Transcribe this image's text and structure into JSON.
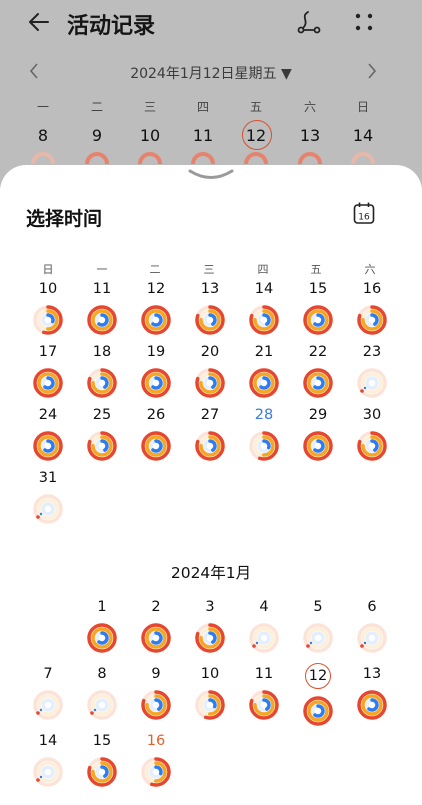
{
  "header": {
    "title": "活动记录",
    "date_text": "2024年1月12日星期五 ▼"
  },
  "top_week": {
    "weekday_labels": [
      "一",
      "二",
      "三",
      "四",
      "五",
      "六",
      "日"
    ],
    "days": [
      "8",
      "9",
      "10",
      "11",
      "12",
      "13",
      "14"
    ],
    "selected_day": "12"
  },
  "sheet": {
    "title": "选择时间",
    "calendar_icon_day": "16",
    "weekday_labels": [
      "日",
      "一",
      "二",
      "三",
      "四",
      "五",
      "六"
    ],
    "dec_days": [
      "10",
      "11",
      "12",
      "13",
      "14",
      "15",
      "16",
      "17",
      "18",
      "19",
      "20",
      "21",
      "22",
      "23",
      "24",
      "25",
      "26",
      "27",
      "28",
      "29",
      "30",
      "31"
    ],
    "jan_title": "2024年1月",
    "jan_days": [
      "1",
      "2",
      "3",
      "4",
      "5",
      "6",
      "7",
      "8",
      "9",
      "10",
      "11",
      "12",
      "13",
      "14",
      "15",
      "16"
    ],
    "jan_selected": "12",
    "jan_today": "16"
  },
  "colors": {
    "accent_red": "#e0502b",
    "ring_red": "#e5472f",
    "ring_orange": "#f5a623",
    "ring_blue": "#2f7cf0",
    "ring_track": "#fde2d8"
  },
  "icons": {
    "back": "back-arrow-icon",
    "route": "route-icon",
    "more": "more-grid-icon",
    "prev": "chevron-left-icon",
    "next": "chevron-right-icon",
    "handle": "sheet-handle-icon",
    "calendar": "calendar-icon"
  }
}
